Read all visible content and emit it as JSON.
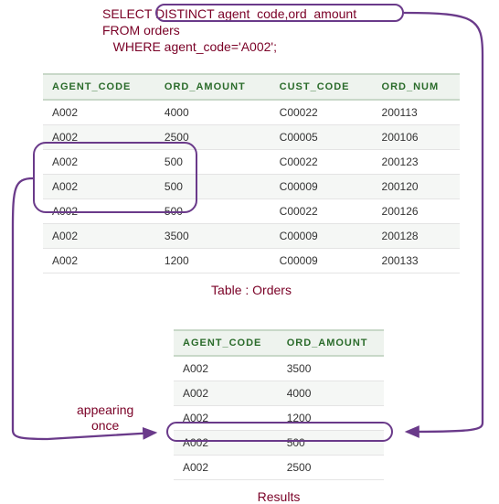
{
  "sql": {
    "line1a": "SELECT ",
    "line1b": "DISTINCT agent_code,ord_amount",
    "line2": "FROM orders",
    "line3": "   WHERE agent_code='A002';"
  },
  "orders_table": {
    "caption": "Table : Orders",
    "headers": [
      "AGENT_CODE",
      "ORD_AMOUNT",
      "CUST_CODE",
      "ORD_NUM"
    ],
    "rows": [
      [
        "A002",
        "4000",
        "C00022",
        "200113"
      ],
      [
        "A002",
        "2500",
        "C00005",
        "200106"
      ],
      [
        "A002",
        "500",
        "C00022",
        "200123"
      ],
      [
        "A002",
        "500",
        "C00009",
        "200120"
      ],
      [
        "A002",
        "500",
        "C00022",
        "200126"
      ],
      [
        "A002",
        "3500",
        "C00009",
        "200128"
      ],
      [
        "A002",
        "1200",
        "C00009",
        "200133"
      ]
    ]
  },
  "results_table": {
    "caption": "Results",
    "headers": [
      "AGENT_CODE",
      "ORD_AMOUNT"
    ],
    "rows": [
      [
        "A002",
        "3500"
      ],
      [
        "A002",
        "4000"
      ],
      [
        "A002",
        "1200"
      ],
      [
        "A002",
        "500"
      ],
      [
        "A002",
        "2500"
      ]
    ]
  },
  "labels": {
    "appearing_once": "appearing\nonce"
  },
  "colors": {
    "text_maroon": "#7a0026",
    "header_green": "#2a6b2a",
    "outline_purple": "#6a3a8a"
  }
}
